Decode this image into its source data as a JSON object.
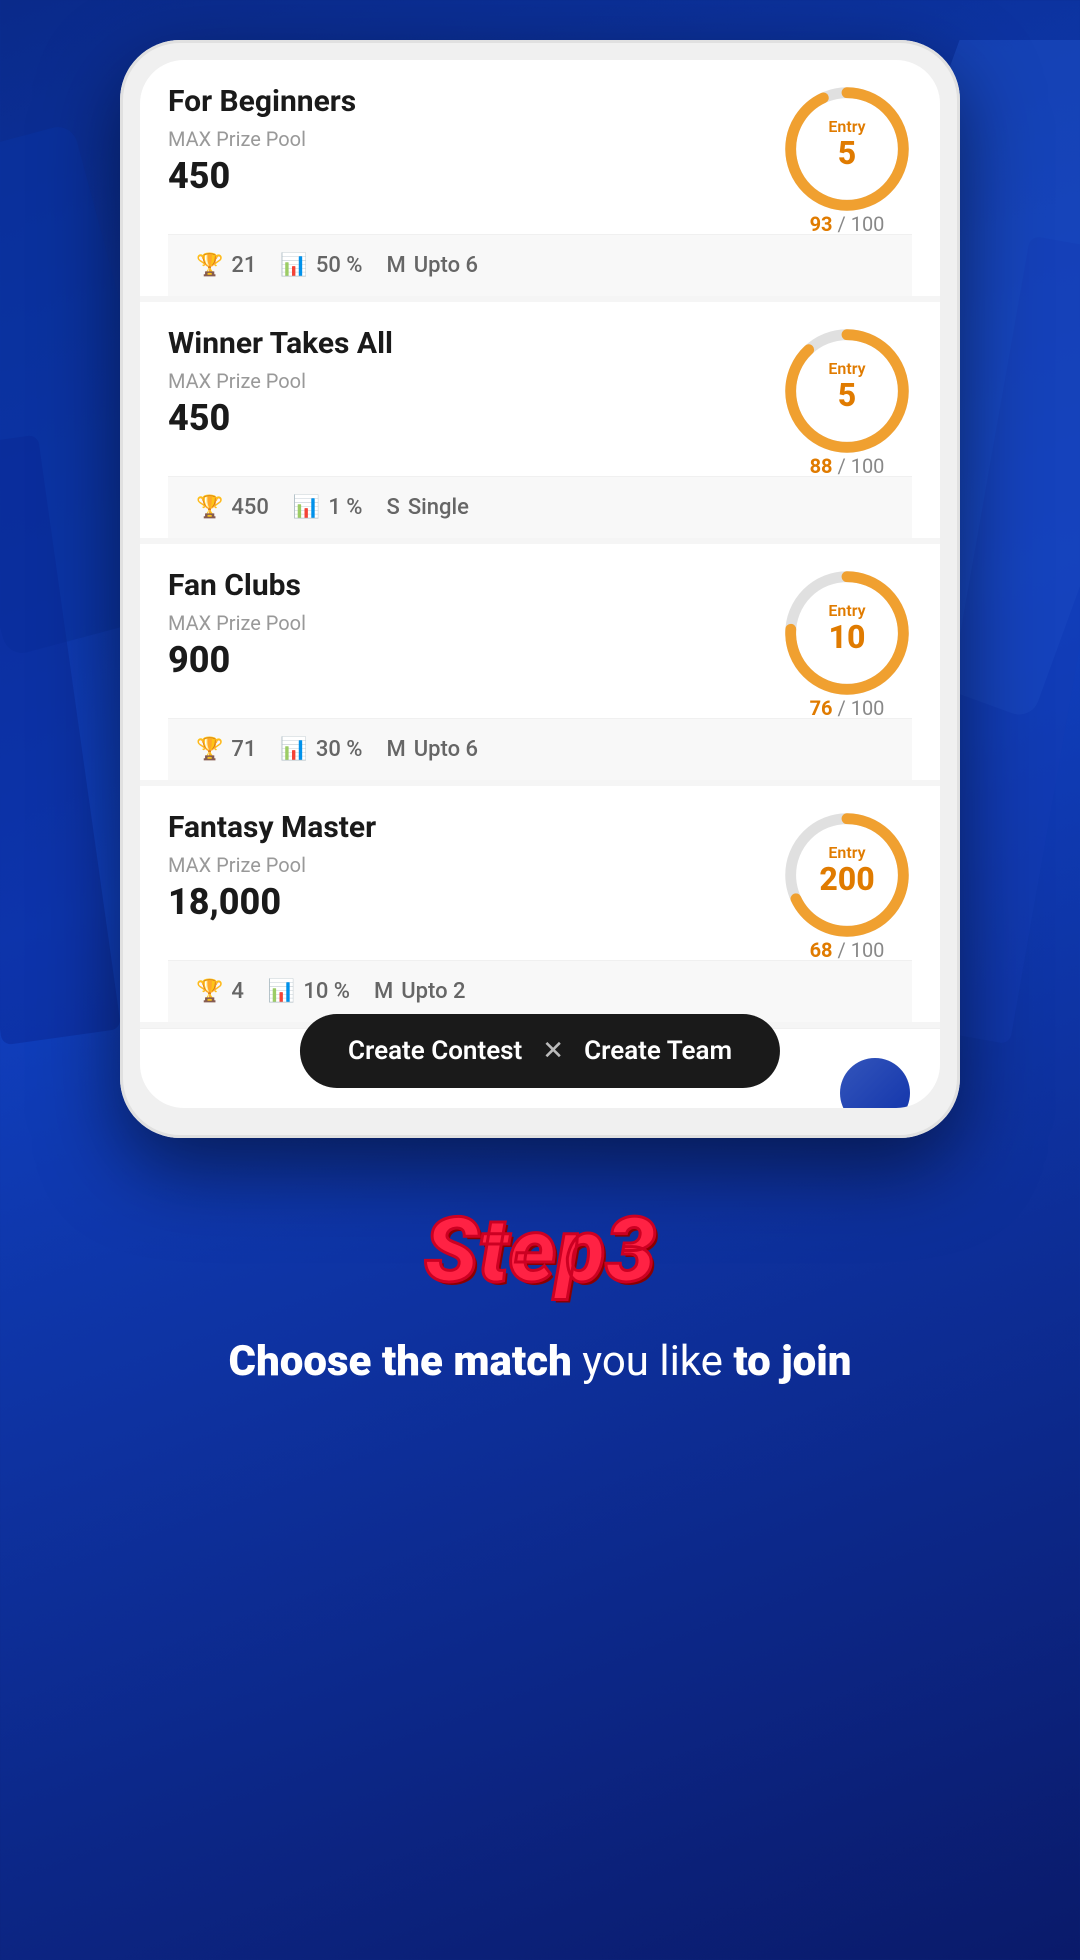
{
  "phone": {
    "contests": [
      {
        "id": "for-beginners",
        "title": "For Beginners",
        "prize_label": "MAX Prize Pool",
        "prize_value": "450",
        "entry_fee": "5",
        "filled": 93,
        "total": 100,
        "stats": [
          {
            "icon": "trophy",
            "value": "21"
          },
          {
            "icon": "bar-chart",
            "value": "50 %"
          },
          {
            "icon": "M",
            "value": "Upto 6"
          }
        ]
      },
      {
        "id": "winner-takes-all",
        "title": "Winner Takes All",
        "prize_label": "MAX Prize Pool",
        "prize_value": "450",
        "entry_fee": "5",
        "filled": 88,
        "total": 100,
        "stats": [
          {
            "icon": "trophy",
            "value": "450"
          },
          {
            "icon": "bar-chart",
            "value": "1 %"
          },
          {
            "icon": "S",
            "value": "Single"
          }
        ]
      },
      {
        "id": "fan-clubs",
        "title": "Fan Clubs",
        "prize_label": "MAX Prize Pool",
        "prize_value": "900",
        "entry_fee": "10",
        "filled": 76,
        "total": 100,
        "stats": [
          {
            "icon": "trophy",
            "value": "71"
          },
          {
            "icon": "bar-chart",
            "value": "30 %"
          },
          {
            "icon": "M",
            "value": "Upto 6"
          }
        ]
      },
      {
        "id": "fantasy-master",
        "title": "Fantasy Master",
        "prize_label": "MAX Prize Pool",
        "prize_value": "18,000",
        "entry_fee": "200",
        "filled": 68,
        "total": 100,
        "stats": [
          {
            "icon": "trophy",
            "value": "4"
          },
          {
            "icon": "bar-chart",
            "value": "10 %"
          },
          {
            "icon": "M",
            "value": "Upto 2"
          }
        ]
      }
    ],
    "action_bar": {
      "create_contest": "Create Contest",
      "divider": "✕",
      "create_team": "Create Team"
    }
  },
  "bottom": {
    "step_title": "Step3",
    "subtitle_bold1": "Choose the match",
    "subtitle_normal": " you like ",
    "subtitle_bold2": "to join"
  }
}
